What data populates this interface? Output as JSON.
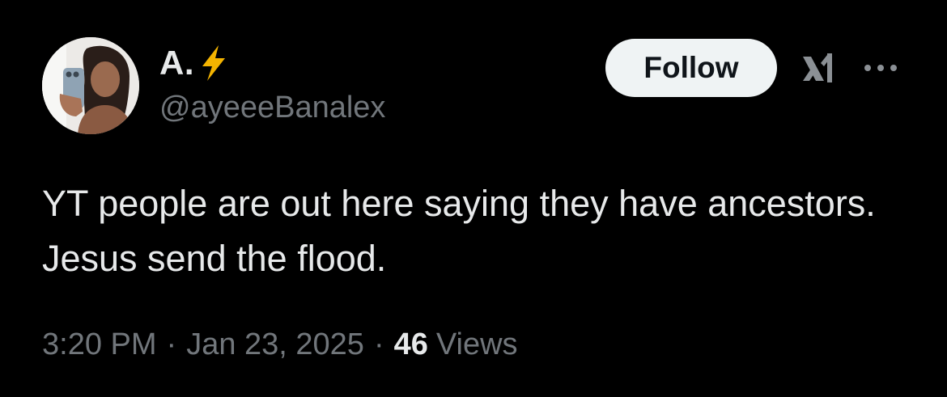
{
  "author": {
    "display_name": "A.",
    "badge_emoji": "high-voltage-emoji",
    "handle": "@ayeeeBanalex",
    "avatar": "profile-photo"
  },
  "actions": {
    "follow_label": "Follow",
    "grok_icon": "grok-icon",
    "more_icon": "more-options-icon"
  },
  "tweet": {
    "text": "YT people are out here saying they have ancestors. Jesus send the flood."
  },
  "meta": {
    "time": "3:20 PM",
    "separator": "·",
    "date": "Jan 23, 2025",
    "views_count": "46",
    "views_label": "Views"
  },
  "colors": {
    "background": "#000000",
    "primary_text": "#e7e9ea",
    "secondary_text": "#71767b",
    "follow_bg": "#eff3f4",
    "follow_text": "#0f1419",
    "emoji": "#f4b400"
  }
}
